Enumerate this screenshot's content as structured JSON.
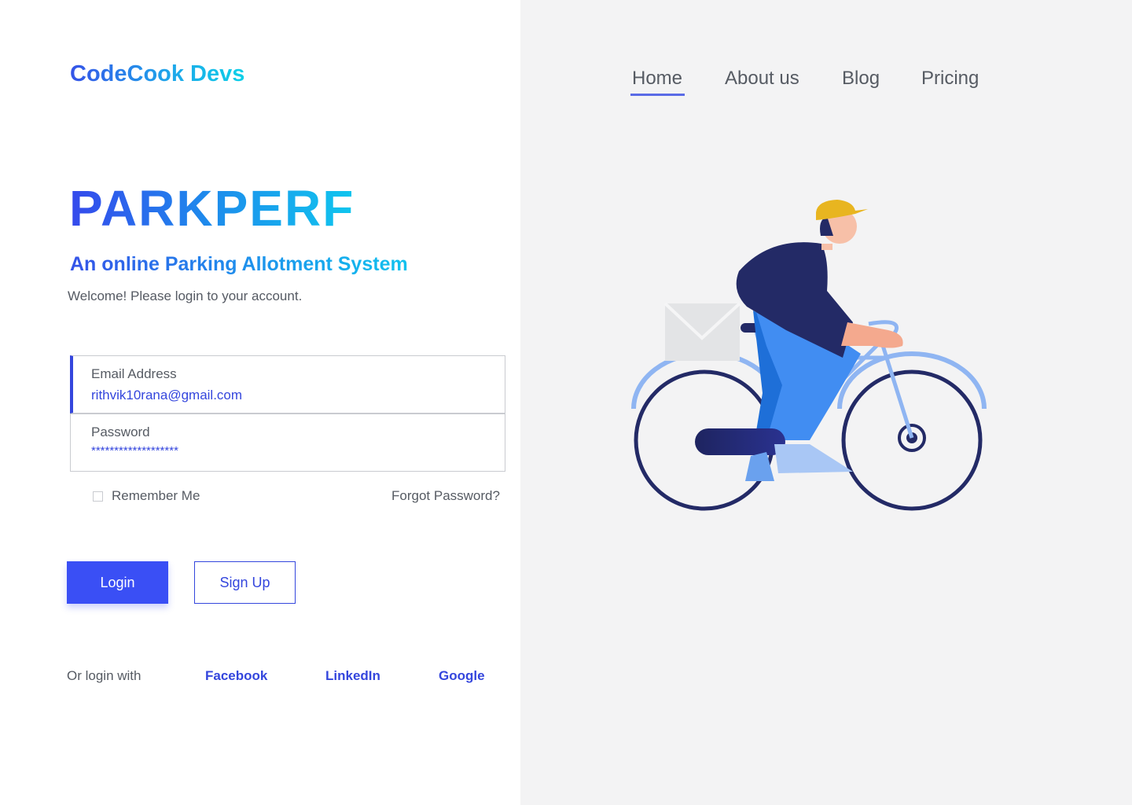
{
  "header": {
    "logo_text": "CodeCook Devs",
    "nav": [
      {
        "label": "Home",
        "active": true
      },
      {
        "label": "About us",
        "active": false
      },
      {
        "label": "Blog",
        "active": false
      },
      {
        "label": "Pricing",
        "active": false
      }
    ]
  },
  "brand": {
    "title": "PARKPERF",
    "subtitle": "An online Parking Allotment System",
    "welcome": "Welcome! Please login to your account."
  },
  "form": {
    "email": {
      "label": "Email Address",
      "value": "rithvik10rana@gmail.com"
    },
    "password": {
      "label": "Password",
      "value": "*******************"
    },
    "remember_label": "Remember Me",
    "remember_checked": false,
    "forgot_label": "Forgot Password?",
    "login_label": "Login",
    "signup_label": "Sign Up"
  },
  "social": {
    "prompt": "Or login with",
    "providers": [
      "Facebook",
      "LinkedIn",
      "Google"
    ]
  },
  "colors": {
    "accent": "#3a4ff5",
    "link": "#3446dd",
    "right_panel_bg": "#f3f3f4",
    "text_muted": "#565b63"
  },
  "illustration": {
    "icon": "cyclist-delivery-illustration"
  }
}
